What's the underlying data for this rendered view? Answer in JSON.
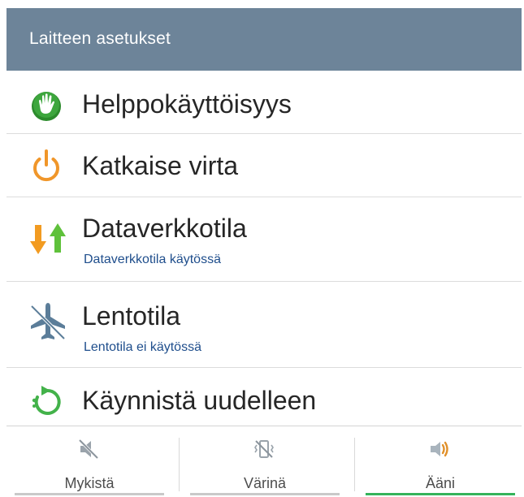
{
  "header": {
    "title": "Laitteen asetukset"
  },
  "menu": {
    "items": [
      {
        "label": "Helppokäyttöisyys",
        "icon": "accessibility-hand-icon"
      },
      {
        "label": "Katkaise virta",
        "icon": "power-icon"
      },
      {
        "label": "Dataverkkotila",
        "subtitle": "Dataverkkotila käytössä",
        "icon": "data-arrows-icon"
      },
      {
        "label": "Lentotila",
        "subtitle": "Lentotila ei käytössä",
        "icon": "airplane-icon"
      },
      {
        "label": "Käynnistä uudelleen",
        "icon": "restart-icon"
      }
    ]
  },
  "sound_modes": {
    "items": [
      {
        "label": "Mykistä",
        "icon": "mute-icon",
        "active": false
      },
      {
        "label": "Värinä",
        "icon": "vibrate-icon",
        "active": false
      },
      {
        "label": "Ääni",
        "icon": "speaker-icon",
        "active": true
      }
    ]
  },
  "colors": {
    "header_bg": "#6d8499",
    "subtitle": "#1f4e8c",
    "active_indicator": "#35b35b",
    "speaker_icon": "#e0902a"
  }
}
